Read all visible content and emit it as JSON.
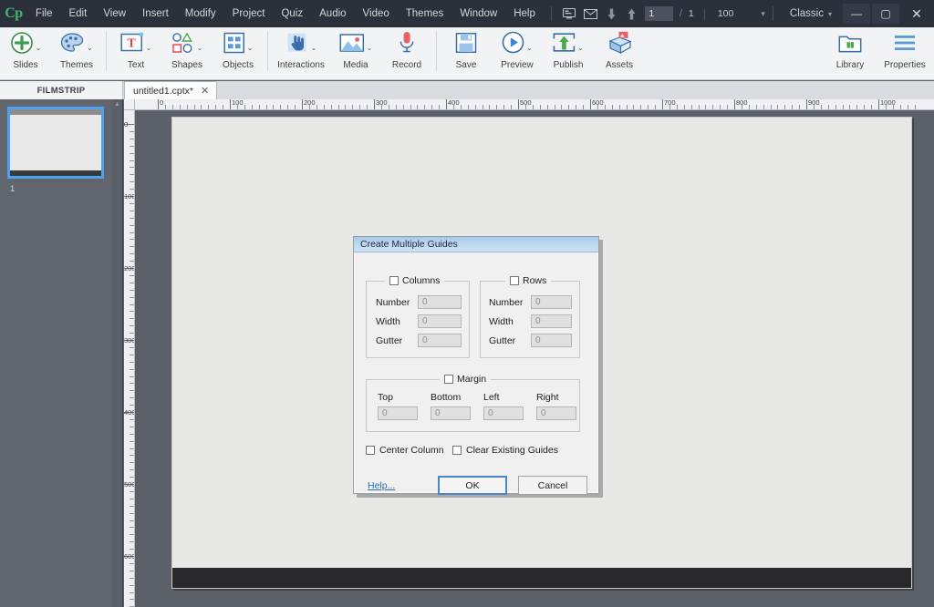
{
  "app": {
    "logo": "Cp",
    "logo_name": "captivate-logo"
  },
  "menubar": {
    "items": [
      "File",
      "Edit",
      "View",
      "Insert",
      "Modify",
      "Project",
      "Quiz",
      "Audio",
      "Video",
      "Themes",
      "Window",
      "Help"
    ],
    "icons": [
      "screen-icon",
      "mail-icon",
      "down-arrow-icon",
      "up-arrow-icon"
    ],
    "slide_current": "1",
    "slide_separator": "/",
    "slide_total": "1",
    "divider": "|",
    "zoom_value": "100",
    "zoom_caret": "▾",
    "workspace": "Classic",
    "workspace_caret": "▾",
    "window_minimize": "—",
    "window_maximize": "▢",
    "window_close": "✕"
  },
  "toolbar": {
    "groups": [
      {
        "items": [
          {
            "label": "Slides",
            "icon": "plus-circle-icon",
            "caret": true
          },
          {
            "label": "Themes",
            "icon": "palette-icon",
            "caret": true
          }
        ]
      },
      {
        "items": [
          {
            "label": "Text",
            "icon": "text-box-icon",
            "caret": true
          },
          {
            "label": "Shapes",
            "icon": "shapes-icon",
            "caret": true
          },
          {
            "label": "Objects",
            "icon": "grid-objects-icon",
            "caret": true
          }
        ]
      },
      {
        "items": [
          {
            "label": "Interactions",
            "icon": "hand-pointer-icon",
            "caret": true
          },
          {
            "label": "Media",
            "icon": "image-icon",
            "caret": true
          },
          {
            "label": "Record",
            "icon": "microphone-icon",
            "caret": false
          }
        ]
      },
      {
        "items": [
          {
            "label": "Save",
            "icon": "floppy-disk-icon",
            "caret": false
          },
          {
            "label": "Preview",
            "icon": "play-circle-icon",
            "caret": true
          },
          {
            "label": "Publish",
            "icon": "publish-upload-icon",
            "caret": true
          },
          {
            "label": "Assets",
            "icon": "assets-box-icon",
            "caret": false
          }
        ]
      }
    ],
    "right_items": [
      {
        "label": "Library",
        "icon": "library-folder-icon",
        "caret": false
      },
      {
        "label": "Properties",
        "icon": "hamburger-lines-icon",
        "caret": false
      }
    ]
  },
  "panels": {
    "filmstrip_title": "FILMSTRIP",
    "slide_number": "1",
    "document_tab": {
      "name": "untitled1.cptx*",
      "close": "✕"
    }
  },
  "rulers": {
    "horizontal_labels": [
      0,
      100,
      200,
      300,
      400,
      500,
      600,
      700,
      800,
      900,
      1000
    ],
    "vertical_labels": [
      0,
      100,
      200,
      300,
      400,
      500,
      600
    ],
    "unit_spacing_px": 0.79
  },
  "dialog": {
    "title": "Create Multiple Guides",
    "columns": {
      "legend": "Columns",
      "checked": false,
      "fields": [
        {
          "label": "Number",
          "value": "0",
          "enabled": false
        },
        {
          "label": "Width",
          "value": "0",
          "enabled": false
        },
        {
          "label": "Gutter",
          "value": "0",
          "enabled": false
        }
      ]
    },
    "rows": {
      "legend": "Rows",
      "checked": false,
      "fields": [
        {
          "label": "Number",
          "value": "0",
          "enabled": false
        },
        {
          "label": "Width",
          "value": "0",
          "enabled": false
        },
        {
          "label": "Gutter",
          "value": "0",
          "enabled": false
        }
      ]
    },
    "margin": {
      "legend": "Margin",
      "checked": false,
      "fields": [
        {
          "label": "Top",
          "value": "0",
          "enabled": false
        },
        {
          "label": "Bottom",
          "value": "0",
          "enabled": false
        },
        {
          "label": "Left",
          "value": "0",
          "enabled": false
        },
        {
          "label": "Right",
          "value": "0",
          "enabled": false
        }
      ]
    },
    "options": [
      {
        "label": "Center Column",
        "checked": false
      },
      {
        "label": "Clear Existing Guides",
        "checked": false
      }
    ],
    "help_link": "Help...",
    "ok_button": "OK",
    "cancel_button": "Cancel"
  },
  "colors": {
    "menubar_bg": "#2b303b",
    "toolbar_bg": "#f2f3f5",
    "filmstrip_bg": "#61656d",
    "workarea_bg": "#5b6069",
    "stage_bg": "#e8e8e6",
    "accent_blue": "#4da2f0",
    "dialog_title_bg": "#bcd7ef",
    "link_blue": "#2a6db5",
    "logo_green": "#3fba6a"
  }
}
